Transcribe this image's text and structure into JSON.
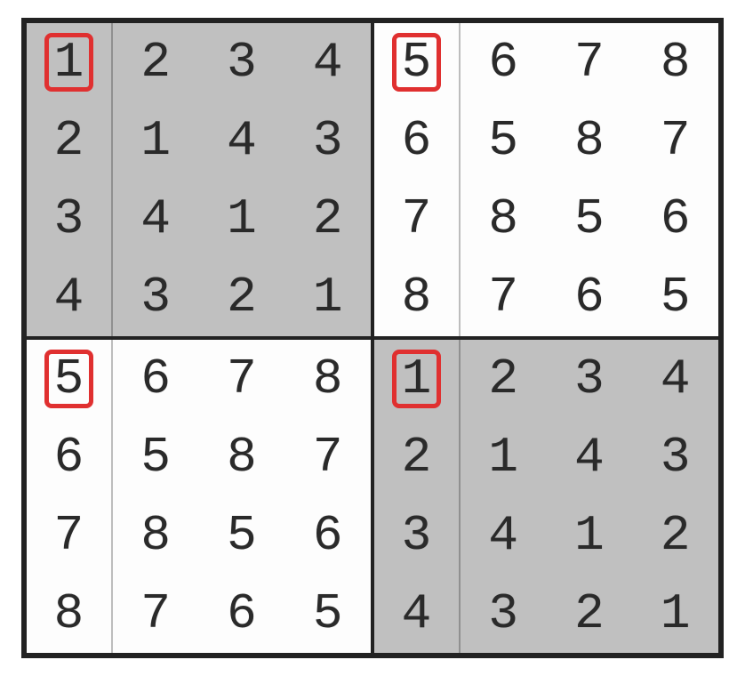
{
  "grid": {
    "quadrants": [
      {
        "shaded": true,
        "rows": [
          [
            1,
            2,
            3,
            4
          ],
          [
            2,
            1,
            4,
            3
          ],
          [
            3,
            4,
            1,
            2
          ],
          [
            4,
            3,
            2,
            1
          ]
        ],
        "highlight": [
          0,
          0
        ]
      },
      {
        "shaded": false,
        "rows": [
          [
            5,
            6,
            7,
            8
          ],
          [
            6,
            5,
            8,
            7
          ],
          [
            7,
            8,
            5,
            6
          ],
          [
            8,
            7,
            6,
            5
          ]
        ],
        "highlight": [
          0,
          0
        ]
      },
      {
        "shaded": false,
        "rows": [
          [
            5,
            6,
            7,
            8
          ],
          [
            6,
            5,
            8,
            7
          ],
          [
            7,
            8,
            5,
            6
          ],
          [
            8,
            7,
            6,
            5
          ]
        ],
        "highlight": [
          0,
          0
        ]
      },
      {
        "shaded": true,
        "rows": [
          [
            1,
            2,
            3,
            4
          ],
          [
            2,
            1,
            4,
            3
          ],
          [
            3,
            4,
            1,
            2
          ],
          [
            4,
            3,
            2,
            1
          ]
        ],
        "highlight": [
          0,
          0
        ]
      }
    ]
  }
}
